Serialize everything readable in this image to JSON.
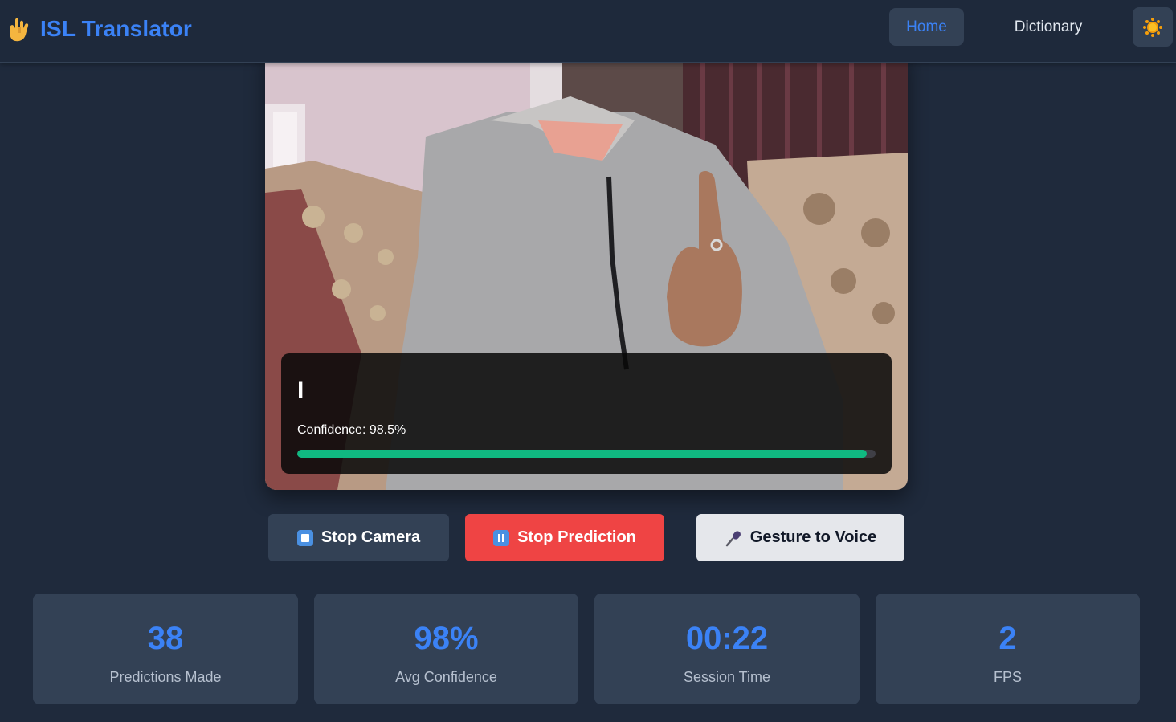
{
  "app": {
    "title": "ISL Translator",
    "logo_icon": "call-me-hand-icon"
  },
  "nav": {
    "home_label": "Home",
    "dictionary_label": "Dictionary",
    "active": "Home",
    "theme_icon": "sun-icon"
  },
  "camera": {
    "prediction": "I",
    "confidence_text": "Confidence: 98.5%",
    "confidence_value": 98.5
  },
  "controls": {
    "stop_camera_label": "Stop Camera",
    "stop_camera_icon": "stop-square-icon",
    "stop_prediction_label": "Stop Prediction",
    "stop_prediction_icon": "pause-icon",
    "gesture_voice_label": "Gesture to Voice",
    "gesture_voice_icon": "microphone-icon"
  },
  "stats": [
    {
      "value": "38",
      "label": "Predictions Made"
    },
    {
      "value": "98%",
      "label": "Avg Confidence"
    },
    {
      "value": "00:22",
      "label": "Session Time"
    },
    {
      "value": "2",
      "label": "FPS"
    }
  ],
  "colors": {
    "accent": "#3b82f6",
    "danger": "#ef4444",
    "success": "#10b981",
    "background": "#1f2a3c",
    "card": "#334155"
  }
}
